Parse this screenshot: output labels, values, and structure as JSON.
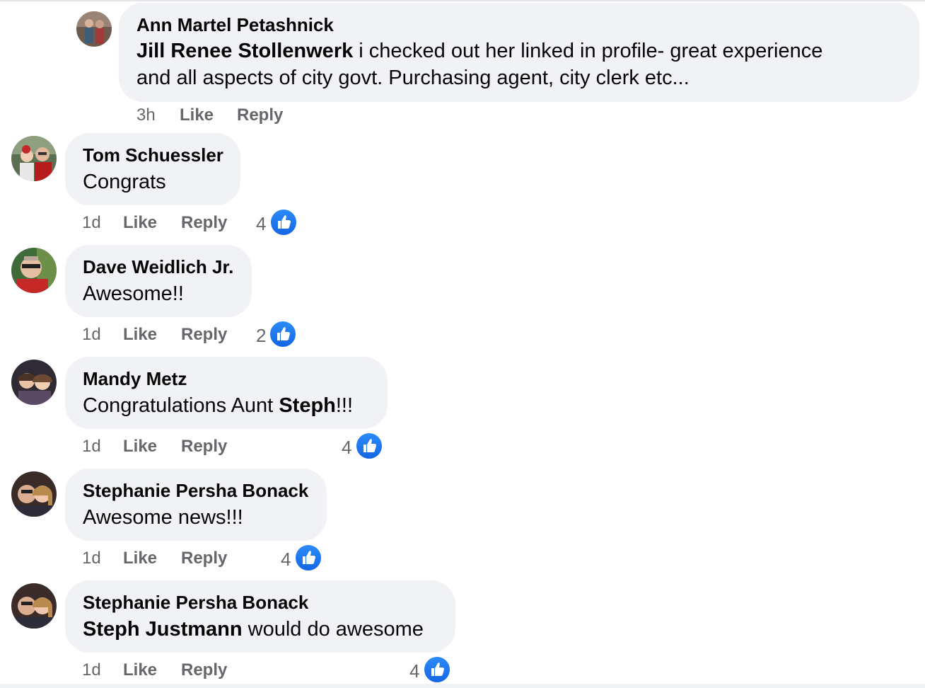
{
  "comments": [
    {
      "author": "Ann Martel Petashnick",
      "mention": "Jill Renee Stollenwerk",
      "text_line1": " i checked out her linked in profile- great experience",
      "text_line2": "and all aspects of city govt. Purchasing agent, city clerk etc...",
      "time": "3h",
      "like": "Like",
      "reply": "Reply",
      "reactions": ""
    },
    {
      "author": "Tom Schuessler",
      "text": "Congrats",
      "time": "1d",
      "like": "Like",
      "reply": "Reply",
      "reactions": "4"
    },
    {
      "author": "Dave Weidlich Jr.",
      "text": "Awesome!!",
      "time": "1d",
      "like": "Like",
      "reply": "Reply",
      "reactions": "2"
    },
    {
      "author": "Mandy Metz",
      "text_before": "Congratulations Aunt ",
      "mention": "Steph",
      "text_after": "!!!",
      "time": "1d",
      "like": "Like",
      "reply": "Reply",
      "reactions": "4"
    },
    {
      "author": "Stephanie Persha Bonack",
      "text": "Awesome news!!!",
      "time": "1d",
      "like": "Like",
      "reply": "Reply",
      "reactions": "4"
    },
    {
      "author": "Stephanie Persha Bonack",
      "mention": "Steph Justmann",
      "text": " would do awesome",
      "time": "1d",
      "like": "Like",
      "reply": "Reply",
      "reactions": "4"
    }
  ],
  "icons": {
    "reaction": "like-thumbs-up-icon",
    "avatar": "profile-photo"
  },
  "colors": {
    "bubble": "#f0f2f5",
    "meta_text": "#65676b",
    "like_blue": "#1b74e4"
  }
}
